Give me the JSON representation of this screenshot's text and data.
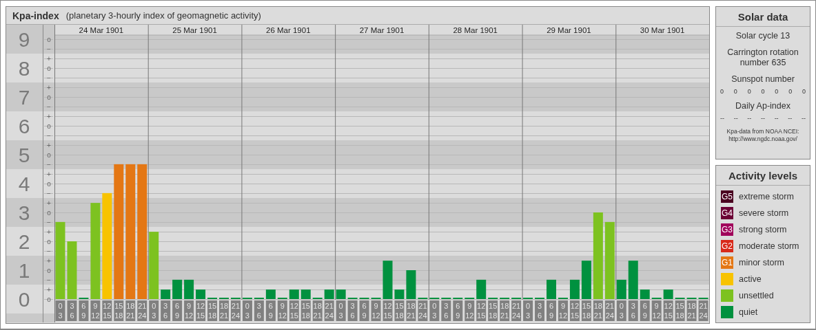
{
  "title": "Kpa-index",
  "subtitle": "(planetary 3-hourly index of geomagnetic activity)",
  "days": [
    {
      "date": "24 Mar 1901",
      "slots": [
        {
          "start": "0",
          "end": "3"
        },
        {
          "start": "3",
          "end": "6"
        },
        {
          "start": "6",
          "end": "9"
        },
        {
          "start": "9",
          "end": "12"
        },
        {
          "start": "12",
          "end": "15"
        },
        {
          "start": "15",
          "end": "18"
        },
        {
          "start": "18",
          "end": "21"
        },
        {
          "start": "21",
          "end": "24"
        }
      ]
    },
    {
      "date": "25 Mar 1901",
      "slots": [
        {
          "start": "0",
          "end": "3"
        },
        {
          "start": "3",
          "end": "6"
        },
        {
          "start": "6",
          "end": "9"
        },
        {
          "start": "9",
          "end": "12"
        },
        {
          "start": "12",
          "end": "15"
        },
        {
          "start": "15",
          "end": "18"
        },
        {
          "start": "18",
          "end": "21"
        },
        {
          "start": "21",
          "end": "24"
        }
      ]
    },
    {
      "date": "26 Mar 1901",
      "slots": [
        {
          "start": "0",
          "end": "3"
        },
        {
          "start": "3",
          "end": "6"
        },
        {
          "start": "6",
          "end": "9"
        },
        {
          "start": "9",
          "end": "12"
        },
        {
          "start": "12",
          "end": "15"
        },
        {
          "start": "15",
          "end": "18"
        },
        {
          "start": "18",
          "end": "21"
        },
        {
          "start": "21",
          "end": "24"
        }
      ]
    },
    {
      "date": "27 Mar 1901",
      "slots": [
        {
          "start": "0",
          "end": "3"
        },
        {
          "start": "3",
          "end": "6"
        },
        {
          "start": "6",
          "end": "9"
        },
        {
          "start": "9",
          "end": "12"
        },
        {
          "start": "12",
          "end": "15"
        },
        {
          "start": "15",
          "end": "18"
        },
        {
          "start": "18",
          "end": "21"
        },
        {
          "start": "21",
          "end": "24"
        }
      ]
    },
    {
      "date": "28 Mar 1901",
      "slots": [
        {
          "start": "0",
          "end": "3"
        },
        {
          "start": "3",
          "end": "6"
        },
        {
          "start": "6",
          "end": "9"
        },
        {
          "start": "9",
          "end": "12"
        },
        {
          "start": "12",
          "end": "15"
        },
        {
          "start": "15",
          "end": "18"
        },
        {
          "start": "18",
          "end": "21"
        },
        {
          "start": "21",
          "end": "24"
        }
      ]
    },
    {
      "date": "29 Mar 1901",
      "slots": [
        {
          "start": "0",
          "end": "3"
        },
        {
          "start": "3",
          "end": "6"
        },
        {
          "start": "6",
          "end": "9"
        },
        {
          "start": "9",
          "end": "12"
        },
        {
          "start": "12",
          "end": "15"
        },
        {
          "start": "15",
          "end": "18"
        },
        {
          "start": "18",
          "end": "21"
        },
        {
          "start": "21",
          "end": "24"
        }
      ]
    },
    {
      "date": "30 Mar 1901",
      "slots": [
        {
          "start": "0",
          "end": "3"
        },
        {
          "start": "3",
          "end": "6"
        },
        {
          "start": "6",
          "end": "9"
        },
        {
          "start": "9",
          "end": "12"
        },
        {
          "start": "12",
          "end": "15"
        },
        {
          "start": "15",
          "end": "18"
        },
        {
          "start": "18",
          "end": "21"
        },
        {
          "start": "21",
          "end": "24"
        }
      ]
    }
  ],
  "minor_ticks": [
    "o",
    "−",
    "+",
    "o",
    "−",
    "+",
    "o",
    "−",
    "+",
    "o",
    "−",
    "+",
    "o",
    "−",
    "+",
    "o",
    "−",
    "+",
    "o",
    "−",
    "+",
    "o",
    "−",
    "+",
    "o",
    "−",
    "+",
    "o"
  ],
  "chart_data": {
    "type": "bar",
    "grid": true,
    "ylim": [
      0,
      9
    ],
    "yticks": [
      0,
      1,
      2,
      3,
      4,
      5,
      6,
      7,
      8,
      9
    ],
    "series": [
      {
        "color": "#00913f",
        "values": [
          null,
          null,
          0,
          null,
          null,
          null,
          null,
          null,
          null,
          0.33,
          0.67,
          0.67,
          0.33,
          0,
          0,
          0,
          0,
          0,
          0.33,
          0,
          0.33,
          0.33,
          0,
          0.33,
          0.33,
          0,
          0,
          0,
          1.33,
          0.33,
          1,
          0,
          0,
          0,
          0,
          0,
          0.67,
          0,
          0,
          0,
          0,
          0,
          0.67,
          0,
          0.67,
          1.33,
          null,
          null,
          0.67,
          1.33,
          0.33,
          0,
          0.33,
          0,
          0,
          0
        ]
      },
      {
        "color": "#7dc220",
        "values": [
          2.67,
          2,
          null,
          3.33,
          null,
          null,
          null,
          null,
          2.33,
          null,
          null,
          null,
          null,
          null,
          null,
          null,
          null,
          null,
          null,
          null,
          null,
          null,
          null,
          null,
          null,
          null,
          null,
          null,
          null,
          null,
          null,
          null,
          null,
          null,
          null,
          null,
          null,
          null,
          null,
          null,
          null,
          null,
          null,
          null,
          null,
          null,
          3,
          2.67,
          null,
          null,
          null,
          null,
          null,
          null,
          null,
          null
        ]
      },
      {
        "color": "#f8c300",
        "values": [
          null,
          null,
          null,
          null,
          3.67,
          null,
          null,
          null,
          null,
          null,
          null,
          null,
          null,
          null,
          null,
          null,
          null,
          null,
          null,
          null,
          null,
          null,
          null,
          null,
          null,
          null,
          null,
          null,
          null,
          null,
          null,
          null,
          null,
          null,
          null,
          null,
          null,
          null,
          null,
          null,
          null,
          null,
          null,
          null,
          null,
          null,
          null,
          null,
          null,
          null,
          null,
          null,
          null,
          null,
          null,
          null
        ]
      },
      {
        "color": "#e47714",
        "values": [
          null,
          null,
          null,
          null,
          null,
          4.67,
          4.67,
          4.67,
          null,
          null,
          null,
          null,
          null,
          null,
          null,
          null,
          null,
          null,
          null,
          null,
          null,
          null,
          null,
          null,
          null,
          null,
          null,
          null,
          null,
          null,
          null,
          null,
          null,
          null,
          null,
          null,
          null,
          null,
          null,
          null,
          null,
          null,
          null,
          null,
          null,
          null,
          null,
          null,
          null,
          null,
          null,
          null,
          null,
          null,
          null,
          null
        ]
      }
    ]
  },
  "solar": {
    "title": "Solar data",
    "cycle": "Solar cycle 13",
    "carrington": "Carrington rotation number 635",
    "sunspot_label": "Sunspot number",
    "sunspot_values": [
      "0",
      "0",
      "0",
      "0",
      "0",
      "0",
      "0"
    ],
    "ap_label": "Daily Ap-index",
    "ap_values": [
      "--",
      "--",
      "--",
      "--",
      "--",
      "--",
      "--"
    ],
    "source": "Kpa-data from NOAA NCEI: http://www.ngdc.noaa.gov/"
  },
  "activity": {
    "title": "Activity levels",
    "items": [
      {
        "code": "G5",
        "label": "extreme storm",
        "color": "#4a0020"
      },
      {
        "code": "G4",
        "label": "severe storm",
        "color": "#6b0035"
      },
      {
        "code": "G3",
        "label": "strong storm",
        "color": "#a0005a"
      },
      {
        "code": "G2",
        "label": "moderate storm",
        "color": "#d82a1a"
      },
      {
        "code": "G1",
        "label": "minor storm",
        "color": "#e47714"
      },
      {
        "label": "active",
        "color": "#f8c300"
      },
      {
        "label": "unsettled",
        "color": "#7dc220"
      },
      {
        "label": "quiet",
        "color": "#00913f"
      }
    ]
  }
}
